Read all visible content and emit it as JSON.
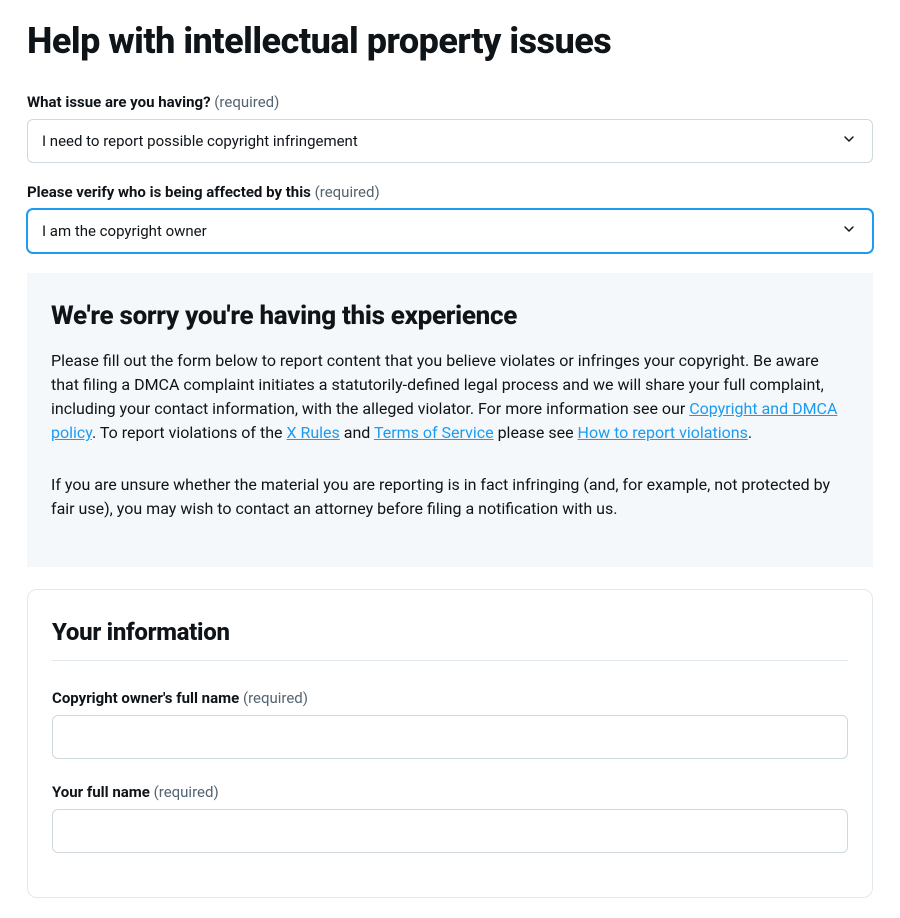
{
  "page": {
    "title": "Help with intellectual property issues"
  },
  "labels": {
    "required": "(required)"
  },
  "fields": {
    "issue": {
      "label": "What issue are you having?",
      "value": "I need to report possible copyright infringement"
    },
    "affected": {
      "label": "Please verify who is being affected by this",
      "value": "I am the copyright owner"
    },
    "owner_name": {
      "label": "Copyright owner's full name",
      "value": ""
    },
    "your_name": {
      "label": "Your full name",
      "value": ""
    }
  },
  "info": {
    "heading": "We're sorry you're having this experience",
    "p1a": "Please fill out the form below to report content that you believe violates or infringes your copyright. Be aware that filing a DMCA complaint initiates a statutorily-defined legal process and we will share your full complaint, including your contact information, with the alleged violator. For more information see our ",
    "link1": "Copyright and DMCA policy",
    "p1b": ". To report violations of the ",
    "link2": "X Rules",
    "p1c": " and ",
    "link3": "Terms of Service",
    "p1d": " please see ",
    "link4": "How to report violations",
    "p1e": ".",
    "p2": "If you are unsure whether the material you are reporting is in fact infringing (and, for example, not protected by fair use), you may wish to contact an attorney before filing a notification with us."
  },
  "section": {
    "your_info": "Your information"
  }
}
